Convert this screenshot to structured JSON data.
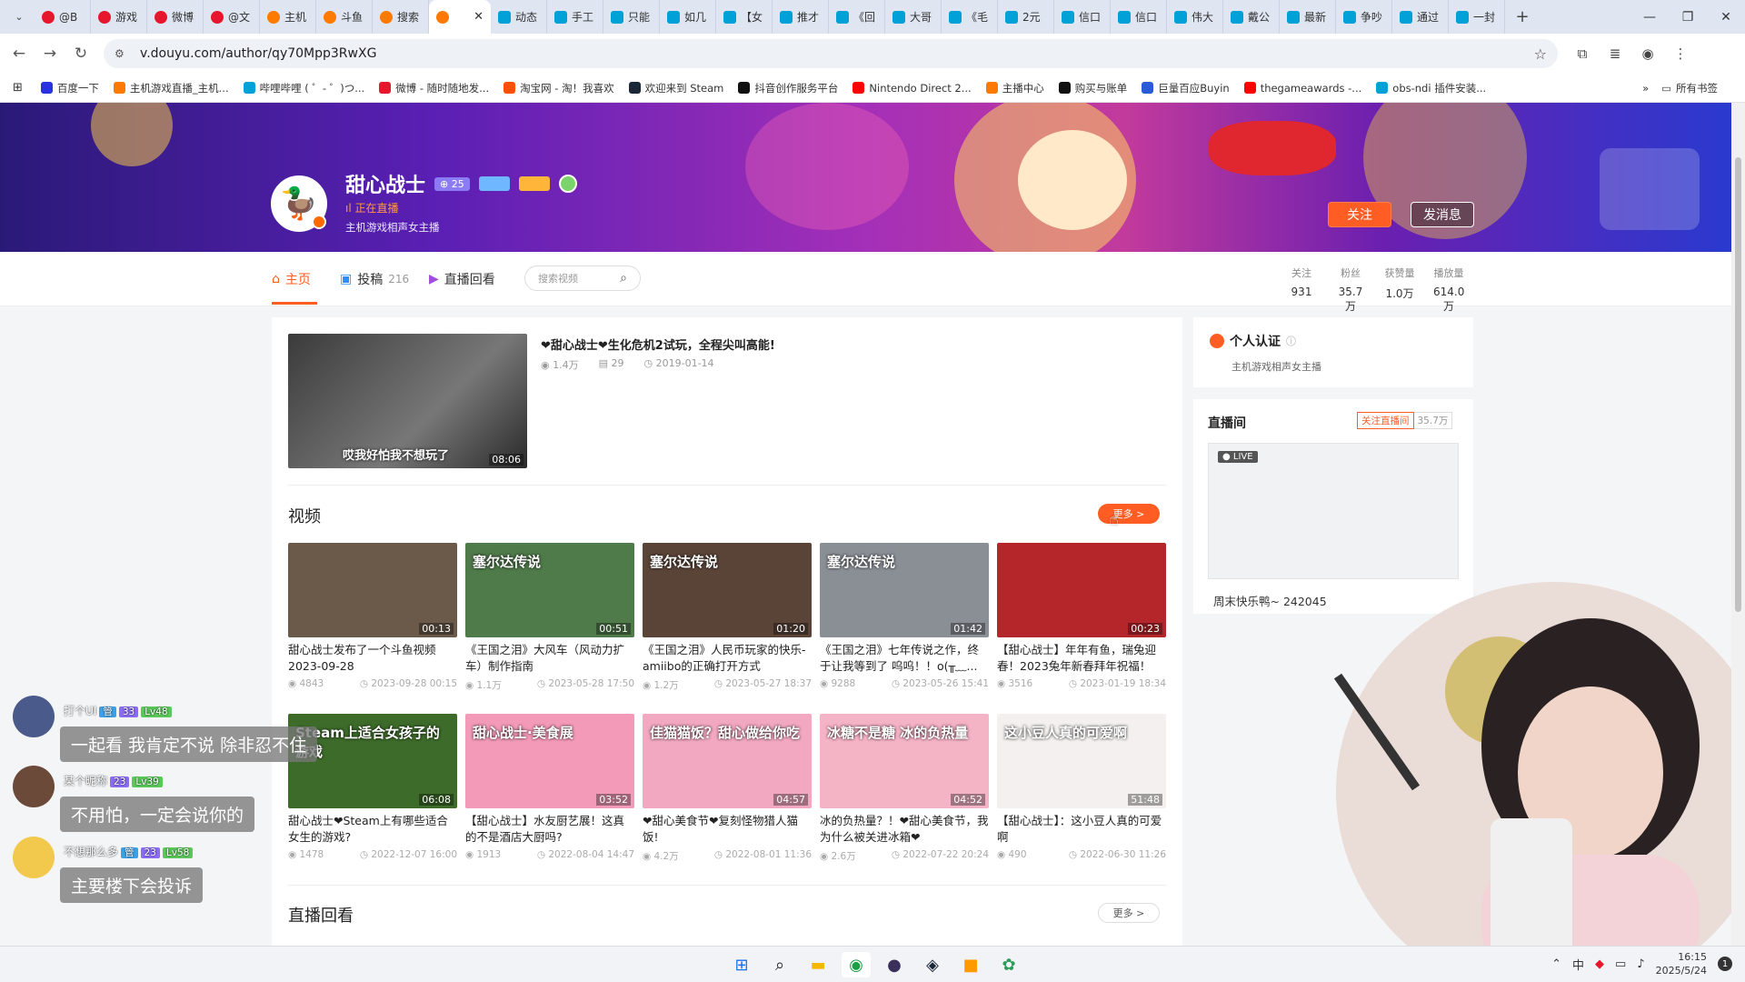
{
  "browser": {
    "tabs": [
      {
        "label": "@B",
        "icon": "weibo"
      },
      {
        "label": "游戏",
        "icon": "weibo"
      },
      {
        "label": "微博",
        "icon": "weibo"
      },
      {
        "label": "@文",
        "icon": "weibo"
      },
      {
        "label": "主机",
        "icon": "douyu"
      },
      {
        "label": "斗鱼",
        "icon": "douyu"
      },
      {
        "label": "搜索",
        "icon": "douyu"
      },
      {
        "label": "",
        "icon": "douyu",
        "active": true
      },
      {
        "label": "动态",
        "icon": "bilibili"
      },
      {
        "label": "手工",
        "icon": "bilibili"
      },
      {
        "label": "只能",
        "icon": "bilibili"
      },
      {
        "label": "如几",
        "icon": "bilibili"
      },
      {
        "label": "【女",
        "icon": "bilibili"
      },
      {
        "label": "推才",
        "icon": "bilibili"
      },
      {
        "label": "《回",
        "icon": "bilibili"
      },
      {
        "label": "大哥",
        "icon": "bilibili"
      },
      {
        "label": "《毛",
        "icon": "bilibili"
      },
      {
        "label": "2元",
        "icon": "bilibili"
      },
      {
        "label": "信口",
        "icon": "bilibili"
      },
      {
        "label": "信口",
        "icon": "bilibili"
      },
      {
        "label": "伟大",
        "icon": "bilibili"
      },
      {
        "label": "戴公",
        "icon": "bilibili"
      },
      {
        "label": "最新",
        "icon": "bilibili"
      },
      {
        "label": "争吵",
        "icon": "bilibili"
      },
      {
        "label": "通过",
        "icon": "bilibili"
      },
      {
        "label": "一封",
        "icon": "bilibili"
      }
    ],
    "url": "v.douyu.com/author/qy70Mpp3RwXG",
    "bookmarks": [
      {
        "label": "百度一下",
        "color": "#2932e1"
      },
      {
        "label": "主机游戏直播_主机...",
        "color": "#ff7a00"
      },
      {
        "label": "哔哩哔哩 ( ゜- ゜)つ...",
        "color": "#00a1d6"
      },
      {
        "label": "微博 - 随时随地发...",
        "color": "#e6162d"
      },
      {
        "label": "淘宝网 - 淘！我喜欢",
        "color": "#ff5000"
      },
      {
        "label": "欢迎来到 Steam",
        "color": "#1b2838"
      },
      {
        "label": "抖音创作服务平台",
        "color": "#111111"
      },
      {
        "label": "Nintendo Direct 2...",
        "color": "#ff0000"
      },
      {
        "label": "主播中心",
        "color": "#ff7a00"
      },
      {
        "label": "购买与账单",
        "color": "#111111"
      },
      {
        "label": "巨量百应Buyin",
        "color": "#2a5bd7"
      },
      {
        "label": "thegameawards -...",
        "color": "#ff0000"
      },
      {
        "label": "obs-ndi 插件安装...",
        "color": "#00a1d6"
      }
    ],
    "bookmarks_all": "所有书签"
  },
  "profile": {
    "name": "甜心战士",
    "level_badge": "25",
    "live_status": "正在直播",
    "bio": "主机游戏相声女主播",
    "follow_label": "关注",
    "message_label": "发消息"
  },
  "subnav": {
    "home": "主页",
    "posts": "投稿",
    "posts_count": "216",
    "replays": "直播回看",
    "search_placeholder": "搜索视频"
  },
  "stats": [
    {
      "label": "关注",
      "value": "931"
    },
    {
      "label": "粉丝",
      "value": "35.7万"
    },
    {
      "label": "获赞量",
      "value": "1.0万"
    },
    {
      "label": "播放量",
      "value": "614.0万"
    }
  ],
  "featured": {
    "title": "❤甜心战士❤生化危机2试玩，全程尖叫高能!",
    "caption": "哎我好怕我不想玩了",
    "duration": "08:06",
    "plays": "1.4万",
    "comments": "29",
    "date": "2019-01-14"
  },
  "videos_section": {
    "title": "视频",
    "more": "更多 >"
  },
  "videos": [
    {
      "title": "甜心战士发布了一个斗鱼视频2023-09-28",
      "duration": "00:13",
      "plays": "4843",
      "date": "2023-09-28 00:15",
      "color": "#6b5a4a"
    },
    {
      "title": "《王国之泪》大风车（风动力扩车）制作指南",
      "duration": "00:51",
      "plays": "1.1万",
      "date": "2023-05-28 17:50",
      "color": "#4f7a4a"
    },
    {
      "title": "《王国之泪》人民币玩家的快乐-amiibo的正确打开方式",
      "duration": "01:20",
      "plays": "1.2万",
      "date": "2023-05-27 18:37",
      "color": "#5a4438"
    },
    {
      "title": "《王国之泪》七年传说之作，终于让我等到了 呜呜！！o(╥﹏...",
      "duration": "01:42",
      "plays": "9288",
      "date": "2023-05-26 15:41",
      "color": "#8a8f96"
    },
    {
      "title": "【甜心战士】年年有鱼，瑞兔迎春！2023兔年新春拜年祝福！",
      "duration": "00:23",
      "plays": "3516",
      "date": "2023-01-19 18:34",
      "color": "#b5262b"
    },
    {
      "title": "甜心战士❤Steam上有哪些适合女生的游戏?",
      "duration": "06:08",
      "plays": "1478",
      "date": "2022-12-07 16:00",
      "color": "#3d6b2a"
    },
    {
      "title": "【甜心战士】水友厨艺展！这真的不是酒店大厨吗?",
      "duration": "03:52",
      "plays": "1913",
      "date": "2022-08-04 14:47",
      "color": "#f39ab8"
    },
    {
      "title": "❤甜心美食节❤复刻怪物猎人猫饭!",
      "duration": "04:57",
      "plays": "4.2万",
      "date": "2022-08-01 11:36",
      "color": "#f2a8c0"
    },
    {
      "title": "冰的负热量？！❤甜心美食节，我为什么被关进冰箱❤",
      "duration": "04:52",
      "plays": "2.6万",
      "date": "2022-07-22 20:24",
      "color": "#f5b3c6"
    },
    {
      "title": "【甜心战士】：这小豆人真的可爱啊",
      "duration": "51:48",
      "plays": "490",
      "date": "2022-06-30 11:26",
      "color": "#f4f0f0"
    }
  ],
  "thumb_overlays": [
    "",
    "塞尔达传说",
    "塞尔达传说",
    "塞尔达传说",
    "",
    "Steam上适合女孩子的游戏",
    "甜心战士·美食展",
    "佳猫猫饭？甜心做给你吃",
    "冰糖不是糖 冰的负热量",
    "这小豆人真的可爱啊"
  ],
  "replay_section": {
    "title": "直播回看",
    "more": "更多 >"
  },
  "side": {
    "cert_title": "个人认证",
    "cert_desc": "主机游戏相声女主播",
    "room_title": "直播间",
    "room_follow": "关注直播间",
    "room_follow_count": "35.7万",
    "live_tag": "LIVE",
    "room_name": "周末快乐鸭~ 242045"
  },
  "chat": [
    {
      "name": "打个UI",
      "chips": [
        "管",
        "33",
        "Lv48"
      ],
      "text": "一起看 我肯定不说 除非忍不住"
    },
    {
      "name": "某个昵称",
      "chips": [
        "23",
        "Lv39"
      ],
      "text": "不用怕，一定会说你的"
    },
    {
      "name": "不想那么多",
      "chips": [
        "管",
        "23",
        "Lv58"
      ],
      "text": "主要楼下会投诉"
    }
  ],
  "taskbar": {
    "time": "16:15",
    "date": "2025/5/24",
    "tray_badge": "1"
  }
}
